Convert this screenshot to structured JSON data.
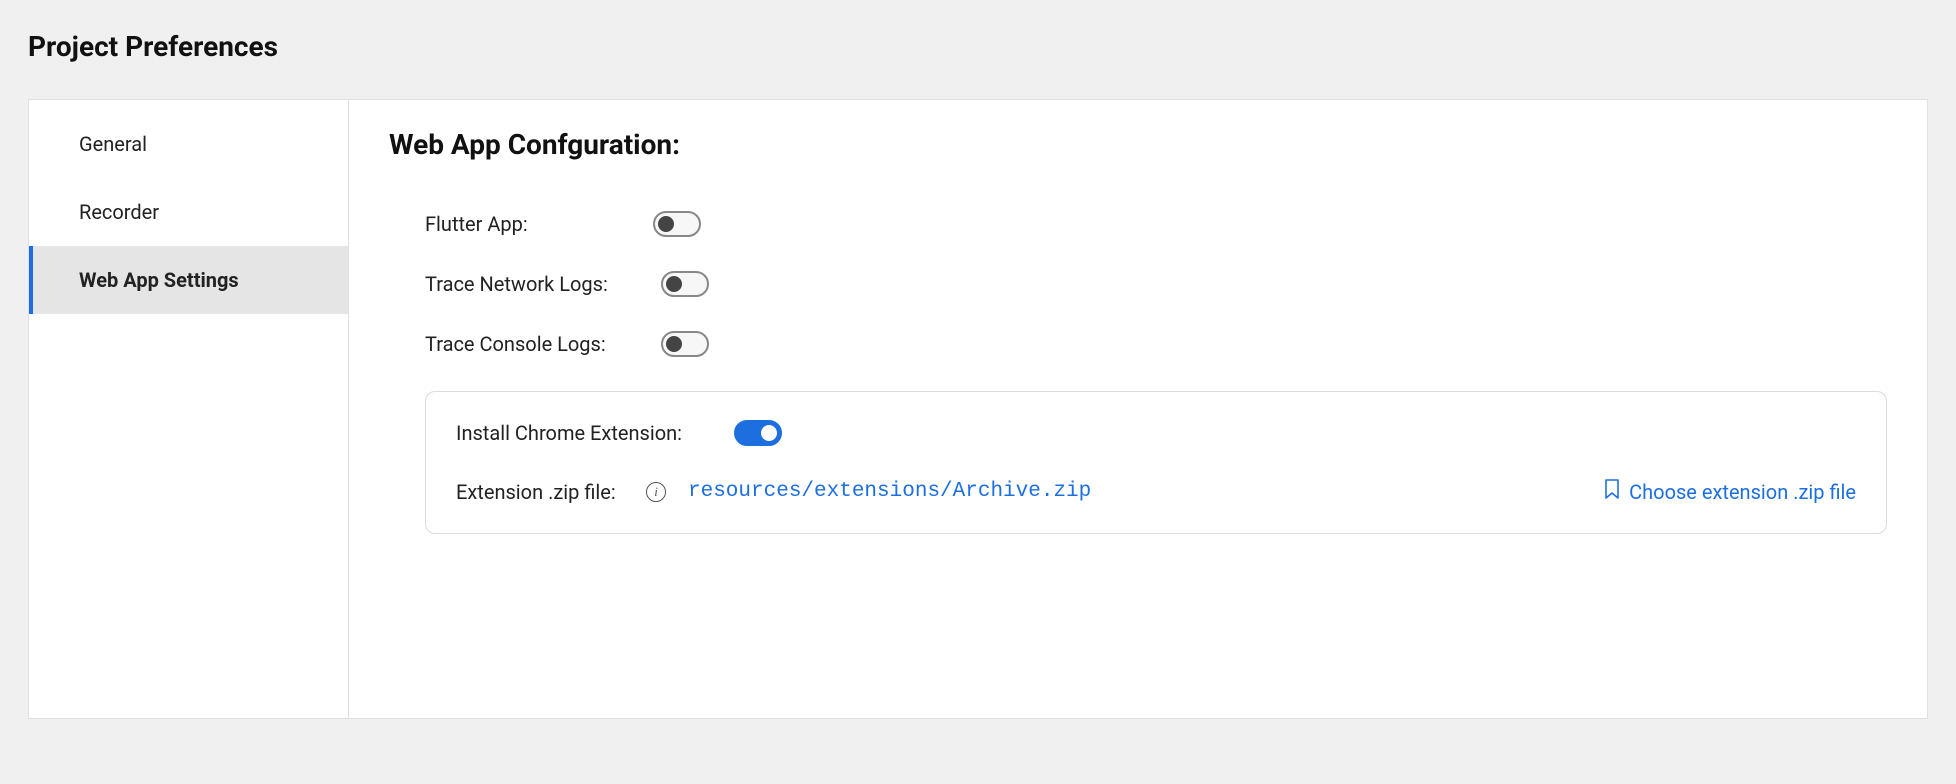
{
  "page_title": "Project Preferences",
  "sidebar": {
    "items": [
      {
        "label": "General",
        "active": false
      },
      {
        "label": "Recorder",
        "active": false
      },
      {
        "label": "Web App Settings",
        "active": true
      }
    ]
  },
  "content": {
    "section_title": "Web App Confguration:",
    "settings": {
      "flutter_app": {
        "label": "Flutter App:",
        "value": false
      },
      "trace_network": {
        "label": "Trace Network Logs:",
        "value": false
      },
      "trace_console": {
        "label": "Trace Console Logs:",
        "value": false
      }
    },
    "extension": {
      "install_label": "Install Chrome Extension:",
      "install_value": true,
      "file_label": "Extension .zip file:",
      "file_path": "resources/extensions/Archive.zip",
      "choose_label": "Choose extension .zip file"
    }
  }
}
